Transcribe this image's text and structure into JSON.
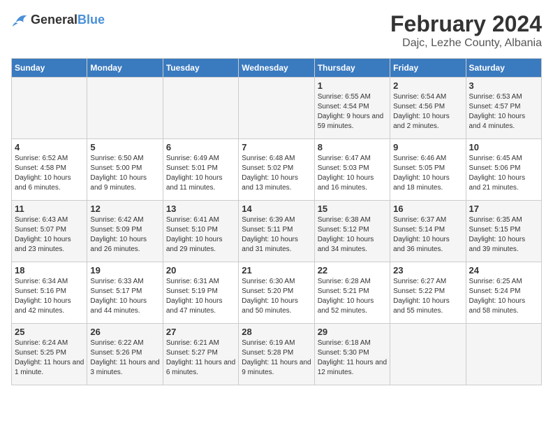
{
  "logo": {
    "general": "General",
    "blue": "Blue"
  },
  "title": "February 2024",
  "subtitle": "Dajc, Lezhe County, Albania",
  "days_of_week": [
    "Sunday",
    "Monday",
    "Tuesday",
    "Wednesday",
    "Thursday",
    "Friday",
    "Saturday"
  ],
  "weeks": [
    [
      {
        "day": "",
        "info": ""
      },
      {
        "day": "",
        "info": ""
      },
      {
        "day": "",
        "info": ""
      },
      {
        "day": "",
        "info": ""
      },
      {
        "day": "1",
        "info": "Sunrise: 6:55 AM\nSunset: 4:54 PM\nDaylight: 9 hours and 59 minutes."
      },
      {
        "day": "2",
        "info": "Sunrise: 6:54 AM\nSunset: 4:56 PM\nDaylight: 10 hours and 2 minutes."
      },
      {
        "day": "3",
        "info": "Sunrise: 6:53 AM\nSunset: 4:57 PM\nDaylight: 10 hours and 4 minutes."
      }
    ],
    [
      {
        "day": "4",
        "info": "Sunrise: 6:52 AM\nSunset: 4:58 PM\nDaylight: 10 hours and 6 minutes."
      },
      {
        "day": "5",
        "info": "Sunrise: 6:50 AM\nSunset: 5:00 PM\nDaylight: 10 hours and 9 minutes."
      },
      {
        "day": "6",
        "info": "Sunrise: 6:49 AM\nSunset: 5:01 PM\nDaylight: 10 hours and 11 minutes."
      },
      {
        "day": "7",
        "info": "Sunrise: 6:48 AM\nSunset: 5:02 PM\nDaylight: 10 hours and 13 minutes."
      },
      {
        "day": "8",
        "info": "Sunrise: 6:47 AM\nSunset: 5:03 PM\nDaylight: 10 hours and 16 minutes."
      },
      {
        "day": "9",
        "info": "Sunrise: 6:46 AM\nSunset: 5:05 PM\nDaylight: 10 hours and 18 minutes."
      },
      {
        "day": "10",
        "info": "Sunrise: 6:45 AM\nSunset: 5:06 PM\nDaylight: 10 hours and 21 minutes."
      }
    ],
    [
      {
        "day": "11",
        "info": "Sunrise: 6:43 AM\nSunset: 5:07 PM\nDaylight: 10 hours and 23 minutes."
      },
      {
        "day": "12",
        "info": "Sunrise: 6:42 AM\nSunset: 5:09 PM\nDaylight: 10 hours and 26 minutes."
      },
      {
        "day": "13",
        "info": "Sunrise: 6:41 AM\nSunset: 5:10 PM\nDaylight: 10 hours and 29 minutes."
      },
      {
        "day": "14",
        "info": "Sunrise: 6:39 AM\nSunset: 5:11 PM\nDaylight: 10 hours and 31 minutes."
      },
      {
        "day": "15",
        "info": "Sunrise: 6:38 AM\nSunset: 5:12 PM\nDaylight: 10 hours and 34 minutes."
      },
      {
        "day": "16",
        "info": "Sunrise: 6:37 AM\nSunset: 5:14 PM\nDaylight: 10 hours and 36 minutes."
      },
      {
        "day": "17",
        "info": "Sunrise: 6:35 AM\nSunset: 5:15 PM\nDaylight: 10 hours and 39 minutes."
      }
    ],
    [
      {
        "day": "18",
        "info": "Sunrise: 6:34 AM\nSunset: 5:16 PM\nDaylight: 10 hours and 42 minutes."
      },
      {
        "day": "19",
        "info": "Sunrise: 6:33 AM\nSunset: 5:17 PM\nDaylight: 10 hours and 44 minutes."
      },
      {
        "day": "20",
        "info": "Sunrise: 6:31 AM\nSunset: 5:19 PM\nDaylight: 10 hours and 47 minutes."
      },
      {
        "day": "21",
        "info": "Sunrise: 6:30 AM\nSunset: 5:20 PM\nDaylight: 10 hours and 50 minutes."
      },
      {
        "day": "22",
        "info": "Sunrise: 6:28 AM\nSunset: 5:21 PM\nDaylight: 10 hours and 52 minutes."
      },
      {
        "day": "23",
        "info": "Sunrise: 6:27 AM\nSunset: 5:22 PM\nDaylight: 10 hours and 55 minutes."
      },
      {
        "day": "24",
        "info": "Sunrise: 6:25 AM\nSunset: 5:24 PM\nDaylight: 10 hours and 58 minutes."
      }
    ],
    [
      {
        "day": "25",
        "info": "Sunrise: 6:24 AM\nSunset: 5:25 PM\nDaylight: 11 hours and 1 minute."
      },
      {
        "day": "26",
        "info": "Sunrise: 6:22 AM\nSunset: 5:26 PM\nDaylight: 11 hours and 3 minutes."
      },
      {
        "day": "27",
        "info": "Sunrise: 6:21 AM\nSunset: 5:27 PM\nDaylight: 11 hours and 6 minutes."
      },
      {
        "day": "28",
        "info": "Sunrise: 6:19 AM\nSunset: 5:28 PM\nDaylight: 11 hours and 9 minutes."
      },
      {
        "day": "29",
        "info": "Sunrise: 6:18 AM\nSunset: 5:30 PM\nDaylight: 11 hours and 12 minutes."
      },
      {
        "day": "",
        "info": ""
      },
      {
        "day": "",
        "info": ""
      }
    ]
  ]
}
